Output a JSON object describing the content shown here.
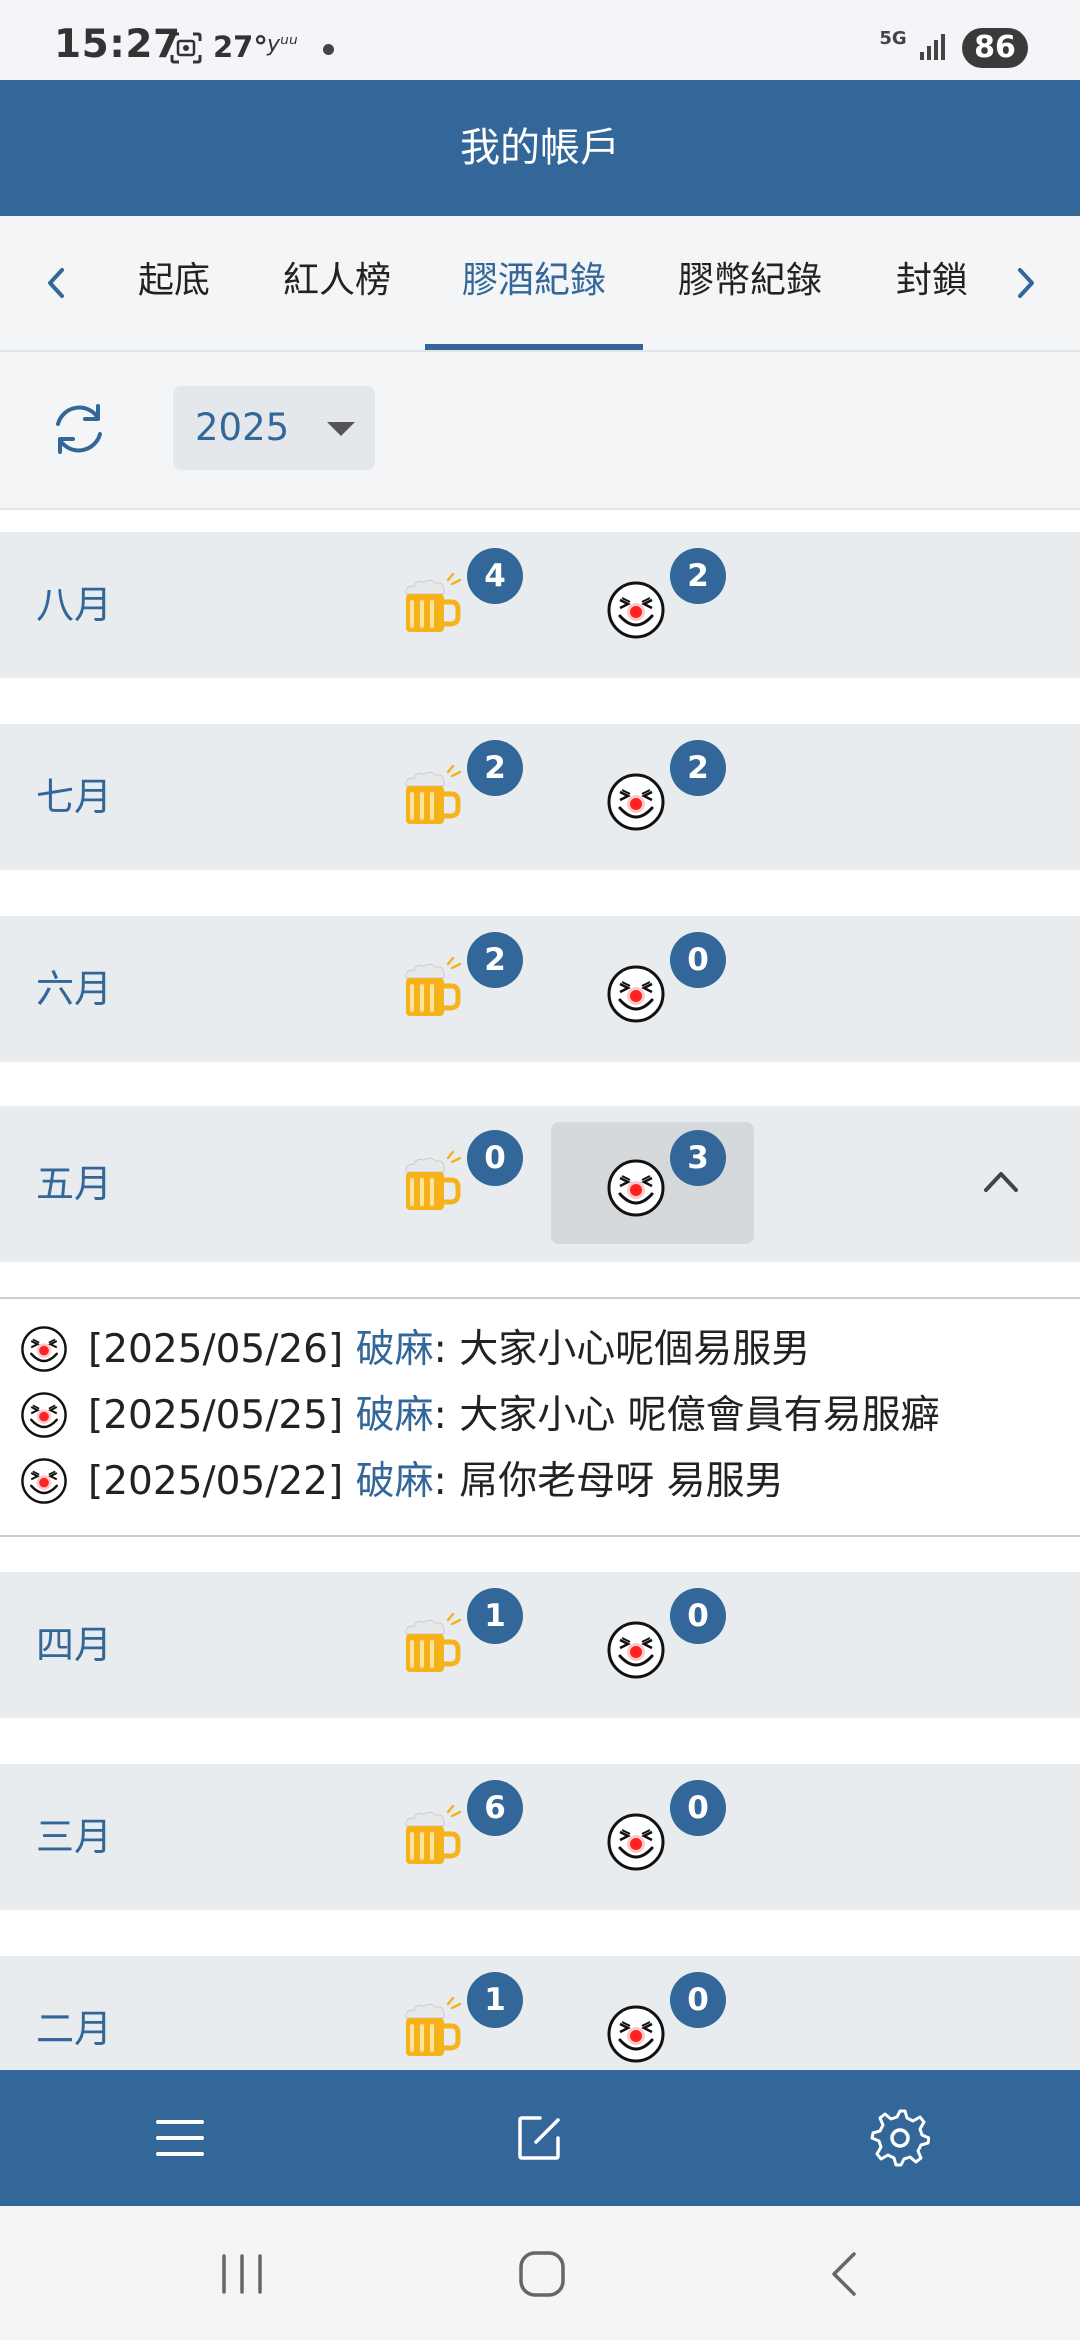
{
  "status_bar": {
    "time": "15:27",
    "temperature": "27°",
    "carrier_text": "yᵘᵘ",
    "network": "5G",
    "battery": "86"
  },
  "header": {
    "title": "我的帳戶"
  },
  "tabs": {
    "items": [
      {
        "label": "起底"
      },
      {
        "label": "紅人榜"
      },
      {
        "label": "膠酒紀錄"
      },
      {
        "label": "膠幣紀錄"
      },
      {
        "label": "封鎖"
      }
    ],
    "active": "膠酒紀錄"
  },
  "toolbar": {
    "year": "2025"
  },
  "months": [
    {
      "label": "八月",
      "beer": "4",
      "clown": "2"
    },
    {
      "label": "七月",
      "beer": "2",
      "clown": "2"
    },
    {
      "label": "六月",
      "beer": "2",
      "clown": "0"
    },
    {
      "label": "五月",
      "beer": "0",
      "clown": "3"
    },
    {
      "label": "四月",
      "beer": "1",
      "clown": "0"
    },
    {
      "label": "三月",
      "beer": "6",
      "clown": "0"
    },
    {
      "label": "二月",
      "beer": "1",
      "clown": "0"
    }
  ],
  "may_records": [
    {
      "date": "[2025/05/26]",
      "author": "破麻",
      "message": "大家小心呢個易服男"
    },
    {
      "date": "[2025/05/25]",
      "author": "破麻",
      "message": "大家小心 呢億會員有易服癖"
    },
    {
      "date": "[2025/05/22]",
      "author": "破麻",
      "message": "屌你老母呀 易服男"
    }
  ],
  "colors": {
    "primary": "#336699",
    "row_bg": "#e8ecef",
    "badge": "#336699"
  },
  "icons": {
    "refresh": "refresh-icon",
    "beer": "beer-mug-icon",
    "clown": "clown-face-icon",
    "menu": "menu-icon",
    "compose": "compose-icon",
    "settings": "gear-icon"
  }
}
